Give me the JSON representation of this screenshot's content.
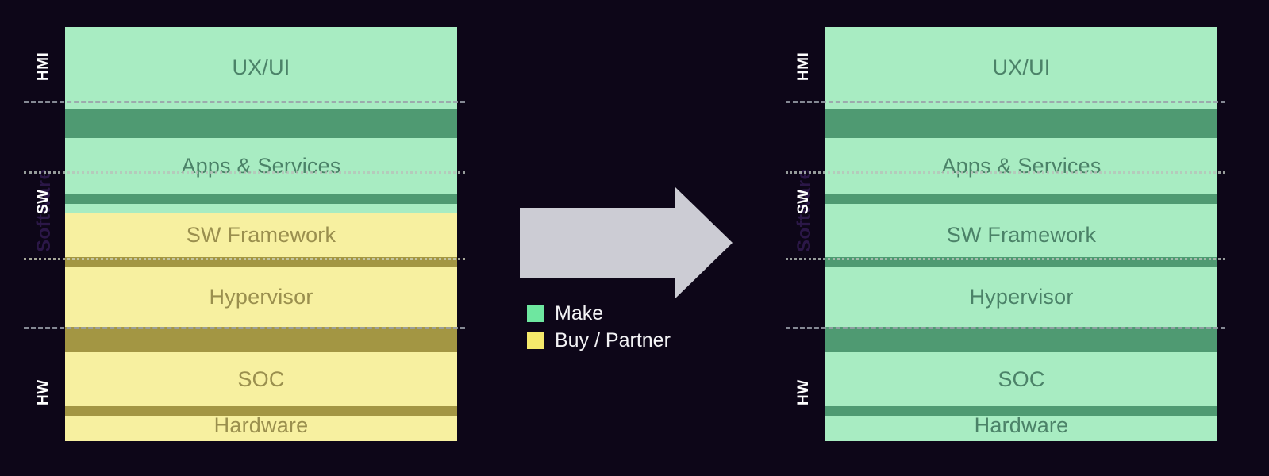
{
  "background_color": "#0d0618",
  "diagram": {
    "title_present": false,
    "layers": [
      "UX/UI",
      "Apps & Services",
      "SW Framework",
      "Hypervisor",
      "SOC",
      "Hardware"
    ],
    "categories": [
      {
        "label": "HMI",
        "layers": [
          "UX/UI"
        ]
      },
      {
        "label": "SW",
        "ghost_label": "Software",
        "layers": [
          "Apps & Services",
          "SW Framework",
          "Hypervisor"
        ]
      },
      {
        "label": "HW",
        "layers": [
          "SOC",
          "Hardware"
        ]
      }
    ],
    "colors": {
      "make_fill": "#a8ecc2",
      "make_divider": "#4f9a72",
      "make_text": "#4b8268",
      "buy_fill": "#f7f0a0",
      "buy_divider": "#a39643",
      "buy_text": "#9a8f4e",
      "legend_make": "#6ee7a0",
      "legend_buy": "#f5e96b",
      "arrow": "#ccccd4",
      "separator": "#9aa0aa",
      "category_label": "#ffffff",
      "ghost_label": "#2b1747"
    },
    "left_stack": {
      "name": "current-state",
      "layers": [
        {
          "label": "UX/UI",
          "fill": "make"
        },
        {
          "label": "Apps & Services",
          "fill": "make"
        },
        {
          "label": "SW Framework",
          "fill": "buy"
        },
        {
          "label": "Hypervisor",
          "fill": "buy"
        },
        {
          "label": "SOC",
          "fill": "buy"
        },
        {
          "label": "Hardware",
          "fill": "buy"
        }
      ]
    },
    "right_stack": {
      "name": "target-state",
      "layers": [
        {
          "label": "UX/UI",
          "fill": "make"
        },
        {
          "label": "Apps & Services",
          "fill": "make"
        },
        {
          "label": "SW Framework",
          "fill": "make"
        },
        {
          "label": "Hypervisor",
          "fill": "make"
        },
        {
          "label": "SOC",
          "fill": "make"
        },
        {
          "label": "Hardware",
          "fill": "make"
        }
      ]
    }
  },
  "legend": {
    "items": [
      {
        "label": "Make",
        "color": "#6ee7a0"
      },
      {
        "label": "Buy / Partner",
        "color": "#f5e96b"
      }
    ]
  },
  "arrow": {
    "direction": "right",
    "color": "#ccccd4"
  }
}
